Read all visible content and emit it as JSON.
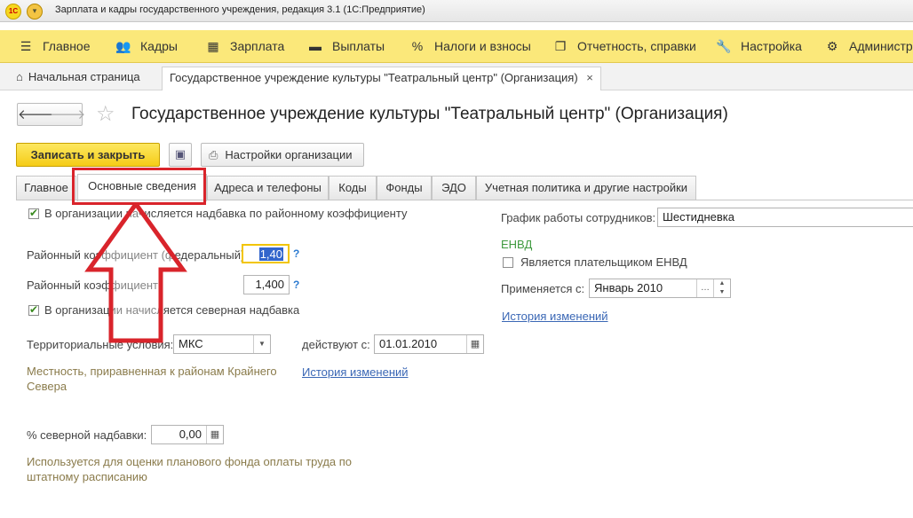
{
  "window": {
    "title": "Зарплата и кадры государственного учреждения, редакция 3.1  (1С:Предприятие)"
  },
  "sections": [
    {
      "label": "Главное",
      "icon": "hamburger-icon"
    },
    {
      "label": "Кадры",
      "icon": "people-icon"
    },
    {
      "label": "Зарплата",
      "icon": "calculator-icon"
    },
    {
      "label": "Выплаты",
      "icon": "money-icon"
    },
    {
      "label": "Налоги и взносы",
      "icon": "percent-icon"
    },
    {
      "label": "Отчетность, справки",
      "icon": "reports-icon"
    },
    {
      "label": "Настройка",
      "icon": "wrench-icon"
    },
    {
      "label": "Администри",
      "icon": "gear-icon"
    }
  ],
  "open_tabs": {
    "home": "Начальная страница",
    "active": "Государственное учреждение культуры \"Театральный центр\" (Организация)"
  },
  "form": {
    "title": "Государственное учреждение культуры \"Театральный центр\" (Организация)",
    "save_close": "Записать и закрыть",
    "org_settings": "Настройки организации",
    "tabs": [
      "Главное",
      "Основные сведения",
      "Адреса и телефоны",
      "Коды",
      "Фонды",
      "ЭДО",
      "Учетная политика и другие настройки"
    ],
    "active_tab": "Основные сведения"
  },
  "left": {
    "chk_district": "В организации начисляется надбавка по районному коэффициенту",
    "district_fed_label": "Районный коэффициент (федеральный):",
    "district_fed_value": "1,40",
    "district_label": "Районный коэффициент:",
    "district_value": "1,400",
    "help": "?",
    "chk_north": "В организации начисляется северная надбавка",
    "territory_label": "Территориальные условия:",
    "territory_value": "МКС",
    "valid_from_label": "действуют с:",
    "valid_from_value": "01.01.2010",
    "territory_hint": "Местность, приравненная к районам Крайнего Севера",
    "history_link": "История изменений",
    "north_pct_label": "% северной надбавки:",
    "north_pct_value": "0,00",
    "north_hint": "Используется для оценки планового фонда оплаты труда по штатному расписанию"
  },
  "right": {
    "schedule_label": "График работы сотрудников:",
    "schedule_value": "Шестидневка",
    "envd_header": "ЕНВД",
    "envd_chk": "Является плательщиком ЕНВД",
    "applied_label": "Применяется с:",
    "applied_value": "Январь 2010",
    "history_link": "История изменений"
  },
  "colors": {
    "section_bar": "#fbe87a",
    "save_button": "#f5cc17",
    "highlight": "#d9242b"
  }
}
